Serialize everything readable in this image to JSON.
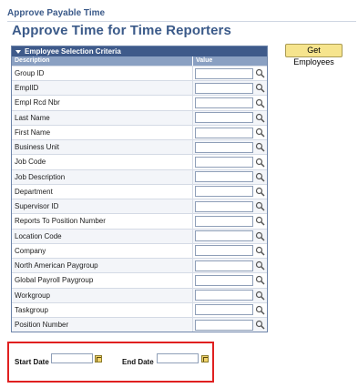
{
  "header": {
    "breadcrumb_title": "Approve Payable Time",
    "page_title": "Approve Time for Time Reporters"
  },
  "actions": {
    "get_employees_label": "Get Employees"
  },
  "criteria": {
    "section_title": "Employee Selection Criteria",
    "col_description": "Description",
    "col_value": "Value",
    "rows": [
      {
        "label": "Group ID",
        "value": ""
      },
      {
        "label": "EmplID",
        "value": ""
      },
      {
        "label": "Empl Rcd Nbr",
        "value": ""
      },
      {
        "label": "Last Name",
        "value": ""
      },
      {
        "label": "First Name",
        "value": ""
      },
      {
        "label": "Business Unit",
        "value": ""
      },
      {
        "label": "Job Code",
        "value": ""
      },
      {
        "label": "Job Description",
        "value": ""
      },
      {
        "label": "Department",
        "value": ""
      },
      {
        "label": "Supervisor ID",
        "value": ""
      },
      {
        "label": "Reports To Position Number",
        "value": ""
      },
      {
        "label": "Location Code",
        "value": ""
      },
      {
        "label": "Company",
        "value": ""
      },
      {
        "label": "North American Paygroup",
        "value": ""
      },
      {
        "label": "Global Payroll Paygroup",
        "value": ""
      },
      {
        "label": "Workgroup",
        "value": ""
      },
      {
        "label": "Taskgroup",
        "value": ""
      },
      {
        "label": "Position Number",
        "value": ""
      }
    ]
  },
  "dates": {
    "start_label": "Start Date",
    "start_value": "",
    "end_label": "End Date",
    "end_value": ""
  },
  "colors": {
    "title": "#3b5a89",
    "panel_header": "#3e5a8a",
    "button": "#f6e48d",
    "highlight_box": "#e02020"
  }
}
